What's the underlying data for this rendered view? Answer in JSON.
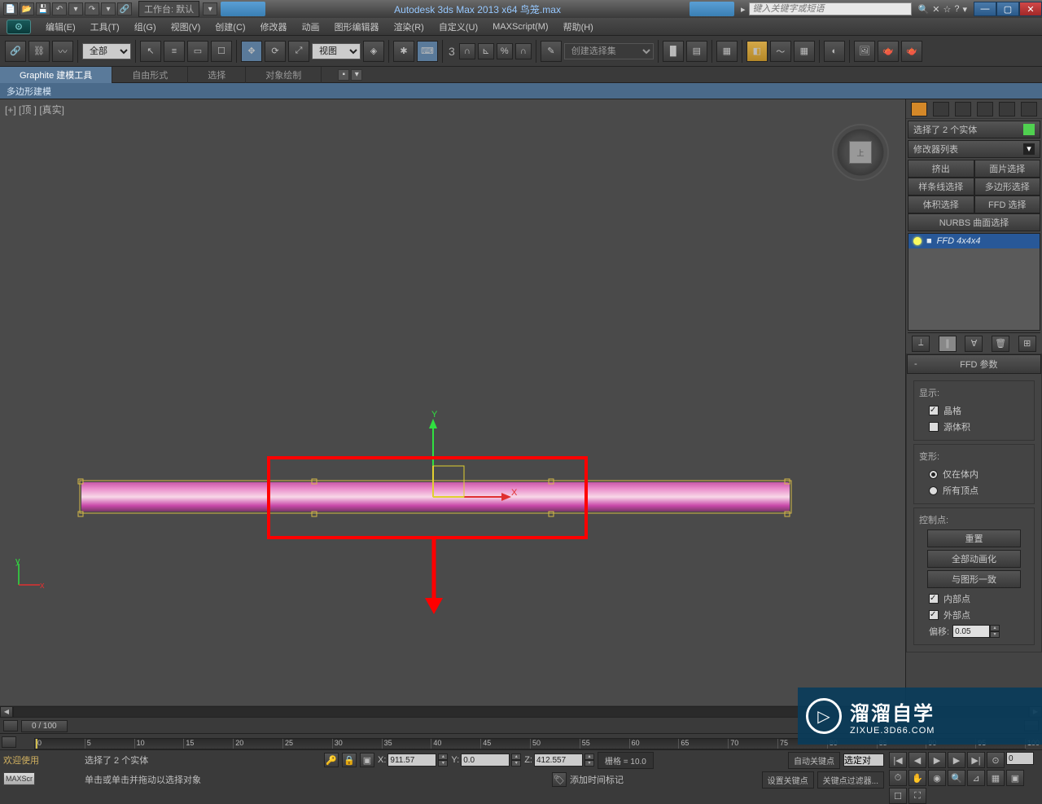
{
  "titlebar": {
    "workspace_label": "工作台: 默认",
    "app_title": "Autodesk 3ds Max  2013 x64    鸟笼.max",
    "search_placeholder": "键入关键字或短语"
  },
  "menus": [
    "编辑(E)",
    "工具(T)",
    "组(G)",
    "视图(V)",
    "创建(C)",
    "修改器",
    "动画",
    "图形编辑器",
    "渲染(R)",
    "自定义(U)",
    "MAXScript(M)",
    "帮助(H)"
  ],
  "toolbar": {
    "filter_label": "全部",
    "view_label": "视图",
    "snap_3": "3",
    "create_set": "创建选择集"
  },
  "ribbon": {
    "tabs": [
      "Graphite 建模工具",
      "自由形式",
      "选择",
      "对象绘制"
    ],
    "sub": "多边形建模"
  },
  "viewport": {
    "label": "[+] [顶 ] [真实]",
    "cube_face": "上",
    "axis_x": "X",
    "axis_y": "Y",
    "gizmo_x": "x",
    "gizmo_y": "y"
  },
  "sidebar": {
    "selection_info": "选择了 2 个实体",
    "modifier_list": "修改器列表",
    "mod_buttons": [
      "挤出",
      "面片选择",
      "样条线选择",
      "多边形选择",
      "体积选择",
      "FFD 选择"
    ],
    "nurbs": "NURBS 曲面选择",
    "stack_item": "FFD 4x4x4",
    "rollout_title": "FFD 参数",
    "display_label": "显示:",
    "lattice": "晶格",
    "source_vol": "源体积",
    "deform_label": "变形:",
    "in_volume": "仅在体内",
    "all_verts": "所有顶点",
    "ctrl_pts": "控制点:",
    "reset": "重置",
    "animate_all": "全部动画化",
    "conform": "与图形一致",
    "inner": "内部点",
    "outer": "外部点",
    "offset": "偏移:",
    "offset_val": "0.05"
  },
  "timeslider": {
    "position": "0 / 100"
  },
  "statusbar": {
    "welcome": "欢迎使用",
    "maxscript": "MAXScr",
    "selection": "选择了 2 个实体",
    "prompt": "单击或单击并拖动以选择对象",
    "x_label": "X:",
    "x_val": "911.57",
    "y_label": "Y:",
    "y_val": "0.0",
    "z_label": "Z:",
    "z_val": "412.557",
    "grid": "栅格 = 10.0",
    "autokey": "自动关键点",
    "selected": "选定对",
    "setkey": "设置关键点",
    "keyfilter": "关键点过滤器...",
    "add_time": "添加时间标记"
  },
  "watermark": {
    "cn": "溜溜自学",
    "url": "ZIXUE.3D66.COM"
  },
  "timeline_ticks": [
    0,
    5,
    10,
    15,
    20,
    25,
    30,
    35,
    40,
    45,
    50,
    55,
    60,
    65,
    70,
    75,
    80,
    85,
    90,
    95,
    100
  ]
}
